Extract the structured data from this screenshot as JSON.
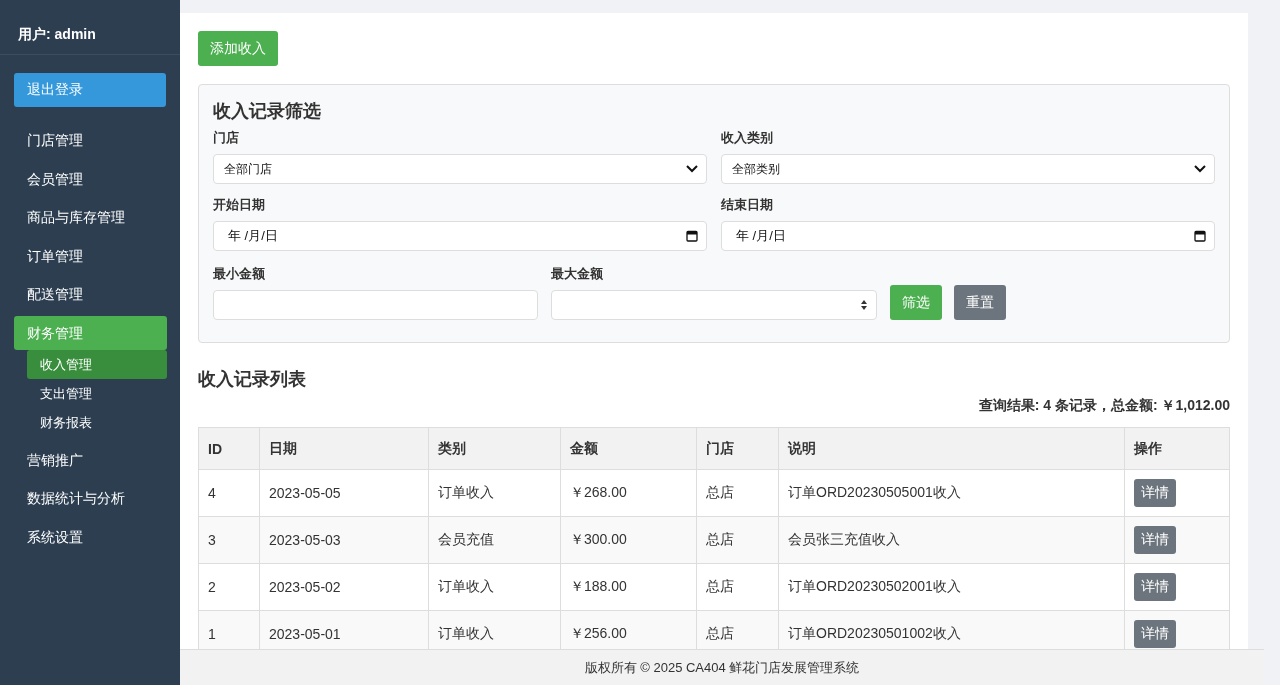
{
  "sidebar": {
    "user": "用户: admin",
    "logout": "退出登录",
    "items": [
      {
        "label": "门店管理",
        "selected": false
      },
      {
        "label": "会员管理",
        "selected": false
      },
      {
        "label": "商品与库存管理",
        "selected": false
      },
      {
        "label": "订单管理",
        "selected": false
      },
      {
        "label": "配送管理",
        "selected": false
      },
      {
        "label": "财务管理",
        "selected": true,
        "children": [
          {
            "label": "收入管理",
            "selected": true
          },
          {
            "label": "支出管理",
            "selected": false
          },
          {
            "label": "财务报表",
            "selected": false
          }
        ]
      },
      {
        "label": "营销推广",
        "selected": false
      },
      {
        "label": "数据统计与分析",
        "selected": false
      },
      {
        "label": "系统设置",
        "selected": false
      }
    ]
  },
  "add_button": "添加收入",
  "filter": {
    "title": "收入记录筛选",
    "store": {
      "label": "门店",
      "value": "全部门店"
    },
    "category": {
      "label": "收入类别",
      "value": "全部类别"
    },
    "start_date": {
      "label": "开始日期",
      "value": "年 /月/日"
    },
    "end_date": {
      "label": "结束日期",
      "value": "年 /月/日"
    },
    "min_amount": {
      "label": "最小金额"
    },
    "max_amount": {
      "label": "最大金额"
    },
    "buttons": [
      "筛选",
      "重置"
    ]
  },
  "list": {
    "title": "收入记录列表",
    "summary": "查询结果: 4 条记录，总金额: ￥1,012.00",
    "columns": [
      "ID",
      "日期",
      "类别",
      "金额",
      "门店",
      "说明",
      "操作"
    ],
    "rows": [
      {
        "id": "4",
        "date": "2023-05-05",
        "category": "订单收入",
        "amount": "￥268.00",
        "store": "总店",
        "note": "订单ORD20230505001收入",
        "action": "详情"
      },
      {
        "id": "3",
        "date": "2023-05-03",
        "category": "会员充值",
        "amount": "￥300.00",
        "store": "总店",
        "note": "会员张三充值收入",
        "action": "详情"
      },
      {
        "id": "2",
        "date": "2023-05-02",
        "category": "订单收入",
        "amount": "￥188.00",
        "store": "总店",
        "note": "订单ORD20230502001收入",
        "action": "详情"
      },
      {
        "id": "1",
        "date": "2023-05-01",
        "category": "订单收入",
        "amount": "￥256.00",
        "store": "总店",
        "note": "订单ORD20230501002收入",
        "action": "详情"
      }
    ]
  },
  "footer": "版权所有 © 2025 CA404 鲜花门店发展管理系统"
}
